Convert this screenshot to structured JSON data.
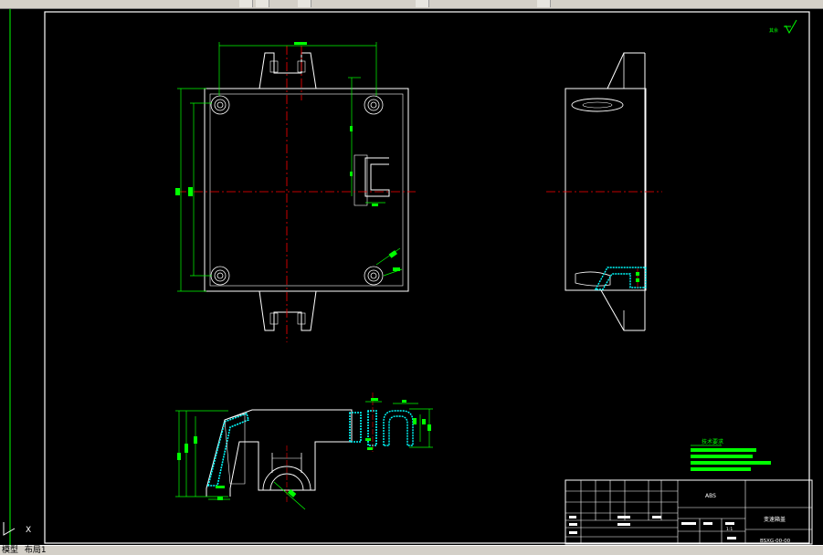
{
  "window": {
    "title": ""
  },
  "title_block": {
    "material": "ABS",
    "part_name": "变速箱盖",
    "drawing_no": "BSXG-00-00",
    "scale": "1:1"
  },
  "tech_requirements": {
    "heading": "技术要求"
  },
  "surface_roughness": {
    "label": "其余"
  },
  "tabs": {
    "model": "模型",
    "layout1": "布局1"
  },
  "ucs": {
    "x_axis": "X"
  },
  "colors": {
    "background": "#000000",
    "outline": "#ffffff",
    "dimension": "#00ff00",
    "center_line": "#ff0000",
    "hatch": "#00ffff",
    "frame": "#00ff00"
  }
}
